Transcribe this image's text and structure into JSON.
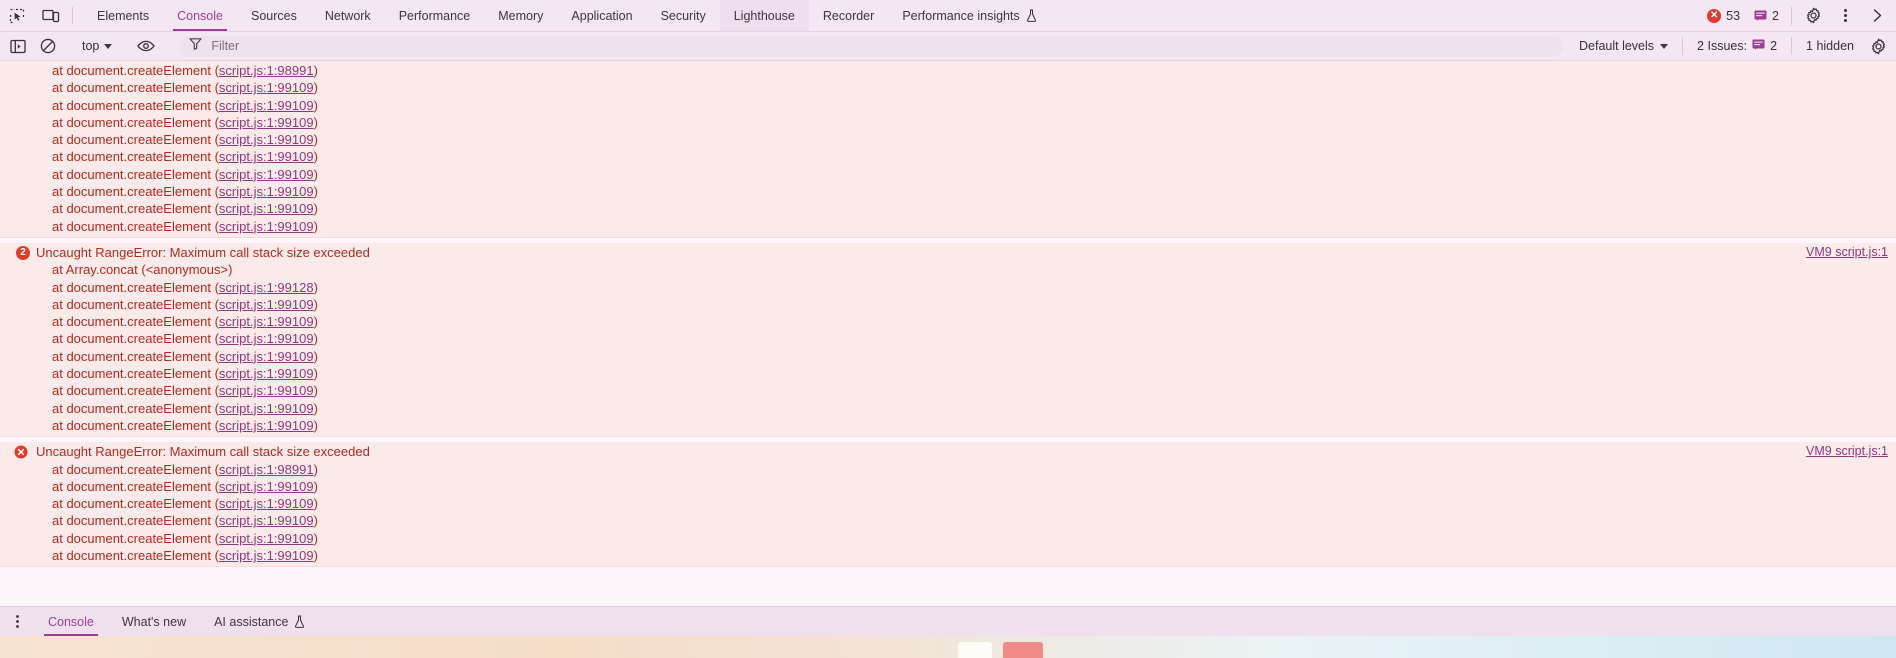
{
  "topbar": {
    "inspect_icon": "inspect-cursor-icon",
    "device_icon": "device-toolbar-icon",
    "tabs": [
      {
        "label": "Elements",
        "state": "normal"
      },
      {
        "label": "Console",
        "state": "active"
      },
      {
        "label": "Sources",
        "state": "normal"
      },
      {
        "label": "Network",
        "state": "normal"
      },
      {
        "label": "Performance",
        "state": "normal"
      },
      {
        "label": "Memory",
        "state": "normal"
      },
      {
        "label": "Application",
        "state": "normal"
      },
      {
        "label": "Security",
        "state": "normal"
      },
      {
        "label": "Lighthouse",
        "state": "hovered"
      },
      {
        "label": "Recorder",
        "state": "normal"
      },
      {
        "label": "Performance insights",
        "state": "normal",
        "icon": "flask-icon"
      }
    ],
    "error_count": "53",
    "message_count": "2",
    "settings_icon": "gear-icon",
    "more_icon": "kebab-menu-icon",
    "close_icon": "chevron-right-icon"
  },
  "filterbar": {
    "sidebar_toggle_icon": "console-sidebar-icon",
    "clear_icon": "clear-console-icon",
    "context": "top",
    "eye_icon": "live-expression-icon",
    "filter_icon": "filter-icon",
    "filter_value": "",
    "filter_placeholder": "Filter",
    "levels_label": "Default levels",
    "issues_label": "2 Issues:",
    "issues_count": "2",
    "issues_icon": "issues-icon",
    "hidden_label": "1 hidden",
    "settings_icon": "gear-icon"
  },
  "console": {
    "groups": [
      {
        "id": "group-0",
        "kind": "stack-continuation",
        "icon": null,
        "badge": null,
        "vmlink": null,
        "lines": [
          {
            "text": "at document.createElement (",
            "link": "script.js:1:98991",
            "tail": ")",
            "indent": "stack"
          },
          {
            "text": "at document.createElement (",
            "link": "script.js:1:99109",
            "tail": ")",
            "indent": "stack"
          },
          {
            "text": "at document.createElement (",
            "link": "script.js:1:99109",
            "tail": ")",
            "indent": "stack"
          },
          {
            "text": "at document.createElement (",
            "link": "script.js:1:99109",
            "tail": ")",
            "indent": "stack"
          },
          {
            "text": "at document.createElement (",
            "link": "script.js:1:99109",
            "tail": ")",
            "indent": "stack"
          },
          {
            "text": "at document.createElement (",
            "link": "script.js:1:99109",
            "tail": ")",
            "indent": "stack"
          },
          {
            "text": "at document.createElement (",
            "link": "script.js:1:99109",
            "tail": ")",
            "indent": "stack"
          },
          {
            "text": "at document.createElement (",
            "link": "script.js:1:99109",
            "tail": ")",
            "indent": "stack"
          },
          {
            "text": "at document.createElement (",
            "link": "script.js:1:99109",
            "tail": ")",
            "indent": "stack"
          },
          {
            "text": "at document.createElement (",
            "link": "script.js:1:99109",
            "tail": ")",
            "indent": "stack"
          }
        ]
      },
      {
        "id": "group-1",
        "kind": "error",
        "icon": null,
        "badge": "2",
        "vmlink": "VM9 script.js:1",
        "lines": [
          {
            "text": "Uncaught RangeError: Maximum call stack size exceeded",
            "link": null,
            "tail": "",
            "indent": "header"
          },
          {
            "text": "at Array.concat (<anonymous>)",
            "link": null,
            "tail": "",
            "indent": "stack"
          },
          {
            "text": "at document.createElement (",
            "link": "script.js:1:99128",
            "tail": ")",
            "indent": "stack"
          },
          {
            "text": "at document.createElement (",
            "link": "script.js:1:99109",
            "tail": ")",
            "indent": "stack"
          },
          {
            "text": "at document.createElement (",
            "link": "script.js:1:99109",
            "tail": ")",
            "indent": "stack"
          },
          {
            "text": "at document.createElement (",
            "link": "script.js:1:99109",
            "tail": ")",
            "indent": "stack"
          },
          {
            "text": "at document.createElement (",
            "link": "script.js:1:99109",
            "tail": ")",
            "indent": "stack"
          },
          {
            "text": "at document.createElement (",
            "link": "script.js:1:99109",
            "tail": ")",
            "indent": "stack"
          },
          {
            "text": "at document.createElement (",
            "link": "script.js:1:99109",
            "tail": ")",
            "indent": "stack"
          },
          {
            "text": "at document.createElement (",
            "link": "script.js:1:99109",
            "tail": ")",
            "indent": "stack"
          },
          {
            "text": "at document.createElement (",
            "link": "script.js:1:99109",
            "tail": ")",
            "indent": "stack"
          }
        ]
      },
      {
        "id": "group-2",
        "kind": "error",
        "icon": "error-circle-x-icon",
        "badge": null,
        "vmlink": "VM9 script.js:1",
        "lines": [
          {
            "text": "Uncaught RangeError: Maximum call stack size exceeded",
            "link": null,
            "tail": "",
            "indent": "header"
          },
          {
            "text": "at document.createElement (",
            "link": "script.js:1:98991",
            "tail": ")",
            "indent": "stack"
          },
          {
            "text": "at document.createElement (",
            "link": "script.js:1:99109",
            "tail": ")",
            "indent": "stack"
          },
          {
            "text": "at document.createElement (",
            "link": "script.js:1:99109",
            "tail": ")",
            "indent": "stack"
          },
          {
            "text": "at document.createElement (",
            "link": "script.js:1:99109",
            "tail": ")",
            "indent": "stack"
          },
          {
            "text": "at document.createElement (",
            "link": "script.js:1:99109",
            "tail": ")",
            "indent": "stack"
          },
          {
            "text": "at document.createElement (",
            "link": "script.js:1:99109",
            "tail": ")",
            "indent": "stack"
          }
        ]
      }
    ]
  },
  "drawer": {
    "kebab_icon": "kebab-menu-icon",
    "tabs": [
      {
        "label": "Console",
        "state": "active"
      },
      {
        "label": "What's new",
        "state": "normal"
      },
      {
        "label": "AI assistance",
        "state": "normal",
        "icon": "flask-icon"
      }
    ]
  },
  "colors": {
    "accent": "#9a3f8f",
    "error_red": "#e33a2e",
    "error_text": "#b02c1f",
    "error_bg": "#fbeaea",
    "chrome_bg": "#f4e6f2",
    "link": "#8c3a7e"
  }
}
